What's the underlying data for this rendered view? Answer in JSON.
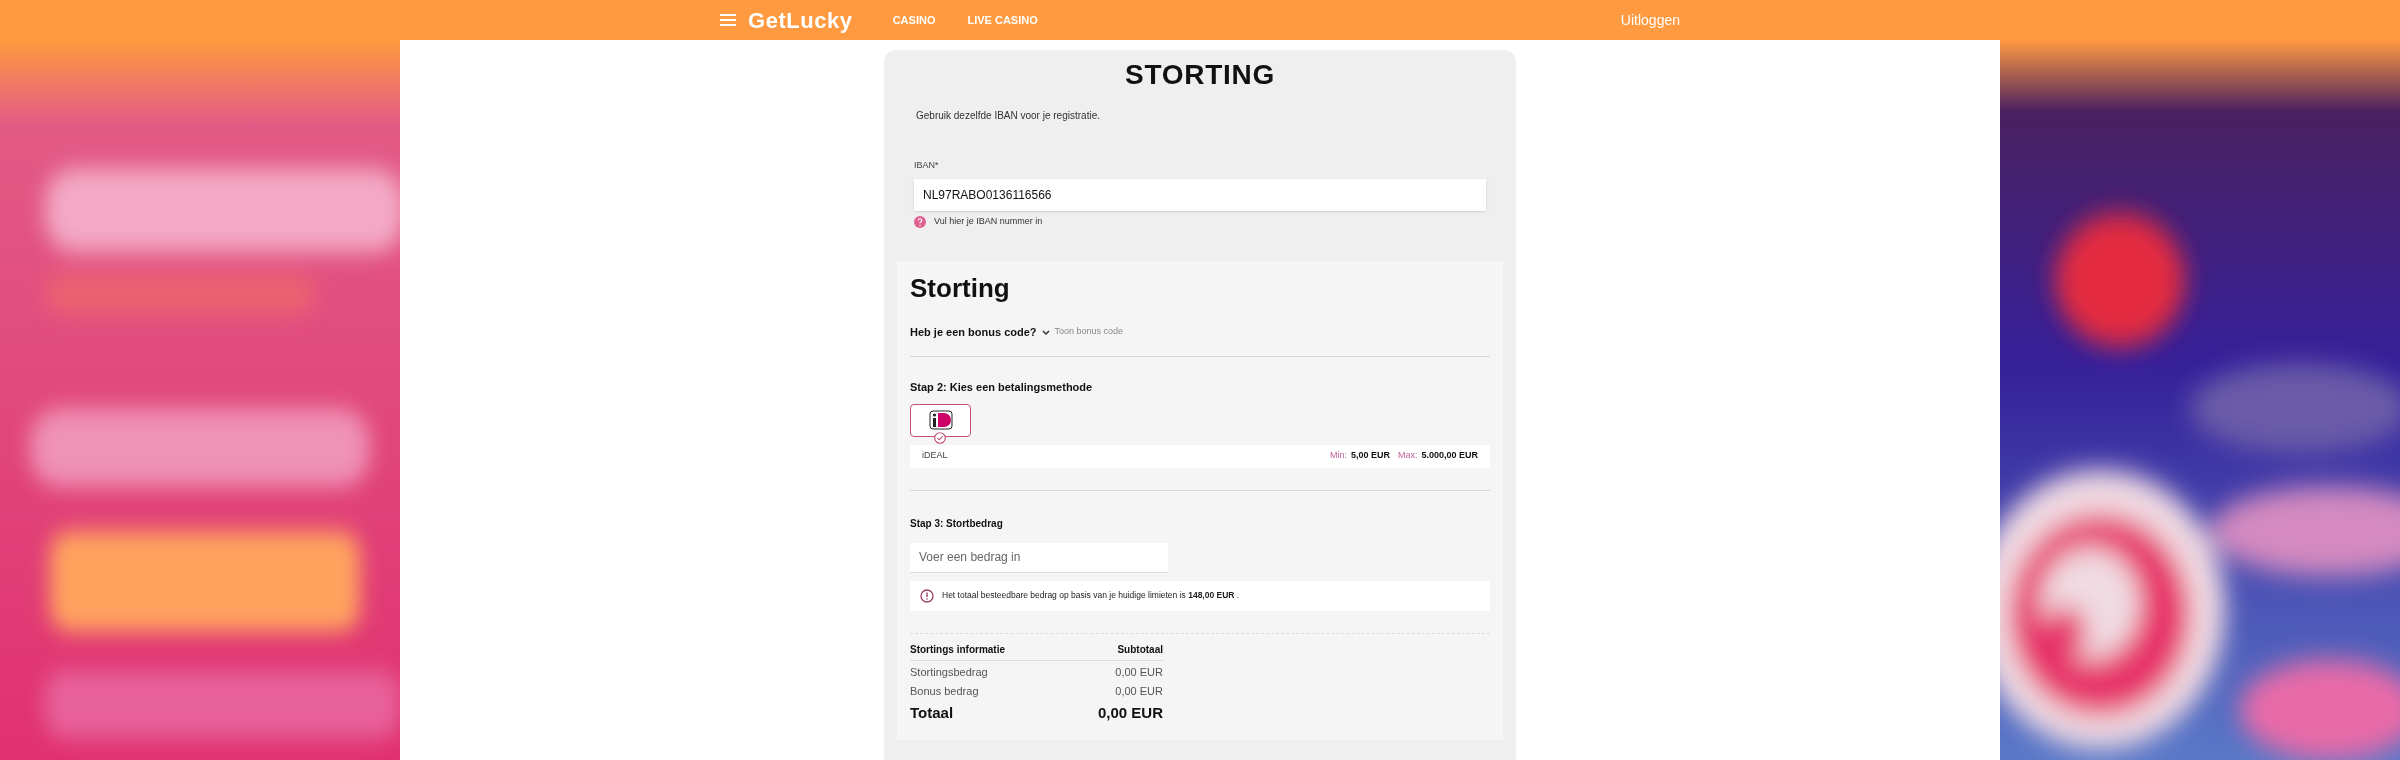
{
  "header": {
    "brand": "GetLucky",
    "nav": [
      {
        "label": "CASINO"
      },
      {
        "label": "LIVE CASINO"
      }
    ],
    "logout": "Uitloggen"
  },
  "deposit": {
    "title": "STORTING",
    "note": "Gebruik dezelfde IBAN voor je registratie.",
    "iban": {
      "label": "IBAN*",
      "value": "NL97RABO0136116566",
      "help": "Vul hier je IBAN nummer in"
    },
    "section": {
      "title": "Storting",
      "bonus": {
        "question": "Heb je een bonus code?",
        "expanded": false,
        "toggle": "Toon bonus code"
      },
      "step2": {
        "heading": "Stap 2: Kies een betalingsmethode",
        "methods": [
          {
            "name": "iDEAL",
            "selected": true
          }
        ],
        "limits": {
          "min_label": "Min:",
          "min": "5,00 EUR",
          "max_label": "Max:",
          "max": "5.000,00 EUR"
        }
      },
      "step3": {
        "heading": "Stap 3: Stortbedrag",
        "amount": {
          "placeholder": "Voer een bedrag in"
        },
        "notice": "Het totaal besteedbare bedrag op basis van je huidige limieten is **148,00 EUR** ."
      },
      "summary": {
        "columns": [
          "Stortings informatie",
          "Subtotaal"
        ],
        "rows": [
          {
            "label": "Stortingsbedrag",
            "value": "0,00 EUR"
          },
          {
            "label": "Bonus bedrag",
            "value": "0,00 EUR"
          }
        ],
        "total": {
          "label": "Totaal",
          "value": "0,00 EUR"
        }
      }
    }
  }
}
